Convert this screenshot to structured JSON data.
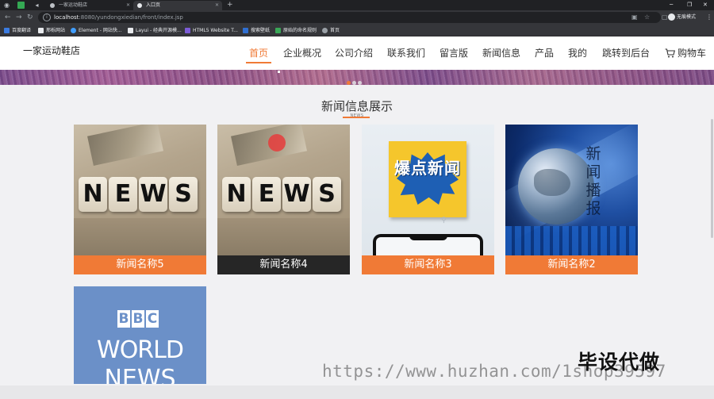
{
  "browser": {
    "tabs": [
      {
        "title": "一家运动鞋店"
      },
      {
        "title": "入口页"
      }
    ],
    "url_host": "localhost",
    "url_rest": ":8080/yundongxiedian/front/index.jsp",
    "profile_label": "无痕模式",
    "bookmarks": [
      {
        "label": "百度翻译",
        "color": "#3b7be0"
      },
      {
        "label": "邢栎网站",
        "color": "#e8eaed"
      },
      {
        "label": "Element - 网站快...",
        "color": "#409eff"
      },
      {
        "label": "Layui - 经典开源模...",
        "color": "#e8eaed"
      },
      {
        "label": "HTML5 Website T...",
        "color": "#7c5cd6"
      },
      {
        "label": "搜索壁纸",
        "color": "#2f6fd1"
      },
      {
        "label": "原始的命名规则",
        "color": "#3aa757"
      },
      {
        "label": "首页",
        "color": "#9aa0a6"
      }
    ]
  },
  "site": {
    "logo": "一家运动鞋店",
    "nav": [
      {
        "label": "首页",
        "active": true
      },
      {
        "label": "企业概况"
      },
      {
        "label": "公司介绍"
      },
      {
        "label": "联系我们"
      },
      {
        "label": "留言版"
      },
      {
        "label": "新闻信息"
      },
      {
        "label": "产品"
      },
      {
        "label": "我的"
      },
      {
        "label": "跳转到后台"
      }
    ],
    "cart_label": "购物车"
  },
  "news_section": {
    "title": "新闻信息展示",
    "subtitle": "NEWS",
    "items": [
      {
        "caption": "新闻名称5",
        "image": "news-dice"
      },
      {
        "caption": "新闻名称4",
        "image": "news-dice"
      },
      {
        "caption": "新闻名称3",
        "image": "baodian-xinwen"
      },
      {
        "caption": "新闻名称2",
        "image": "globe-broadcast"
      },
      {
        "caption": "",
        "image": "bbc-world-news"
      }
    ],
    "image_texts": {
      "dice": [
        "N",
        "E",
        "W",
        "S"
      ],
      "baodian": "爆点新闻",
      "globe": "新闻播报",
      "bbc": [
        "B",
        "B",
        "C"
      ],
      "bbc_world": "WORLD",
      "bbc_news": "NEWS"
    }
  },
  "watermark": {
    "cn": "毕设代做",
    "url": "https://www.huzhan.com/1shop39597"
  },
  "colors": {
    "accent": "#f07a36",
    "header_bg": "#ffffff",
    "page_bg": "#f1f1f3"
  }
}
